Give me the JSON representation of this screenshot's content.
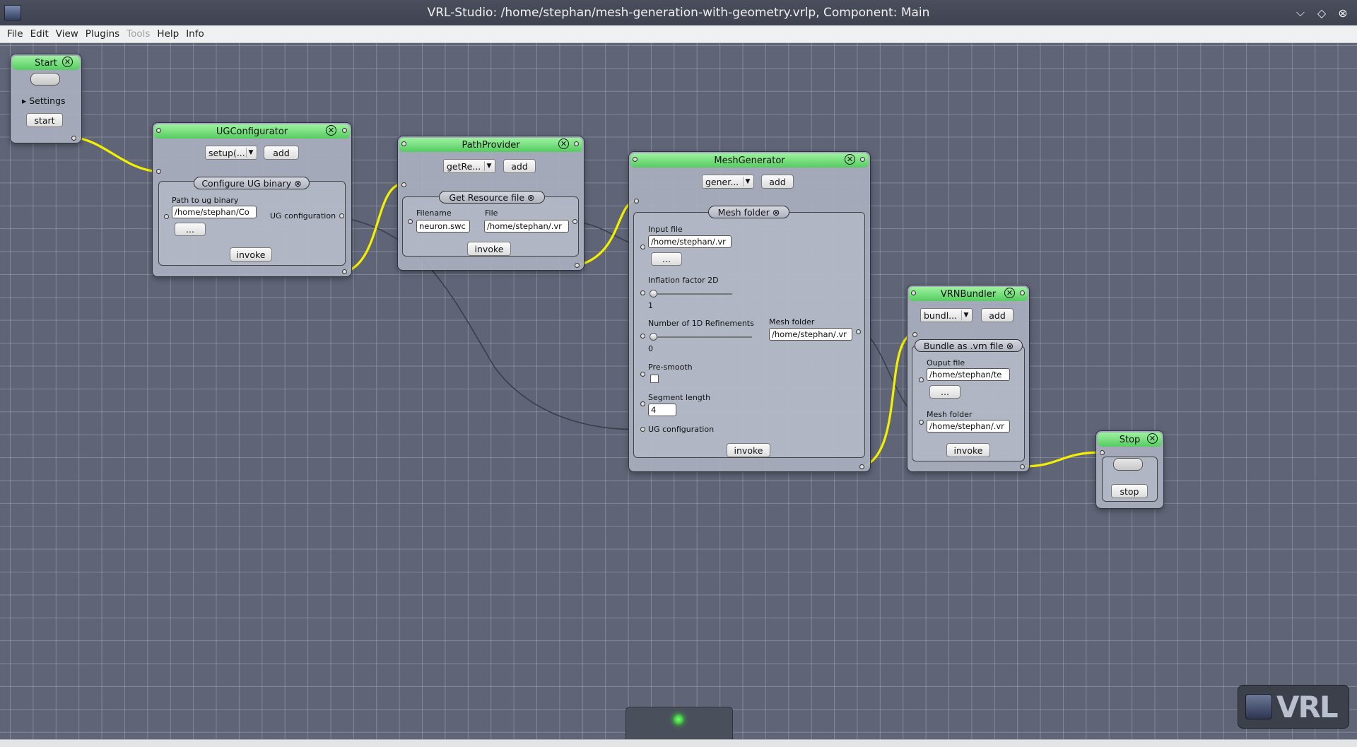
{
  "window": {
    "title": "VRL-Studio: /home/stephan/mesh-generation-with-geometry.vrlp, Component: Main"
  },
  "menu": [
    "File",
    "Edit",
    "View",
    "Plugins",
    "Tools",
    "Help",
    "Info"
  ],
  "start": {
    "title": "Start",
    "settings_label": "Settings",
    "button": "start"
  },
  "ug": {
    "title": "UGConfigurator",
    "method": "setup(...",
    "add": "add",
    "panel_title": "Configure UG binary",
    "path_label": "Path to ug binary",
    "path_value": "/home/stephan/Co",
    "browse": "...",
    "out_label": "UG configuration",
    "invoke": "invoke"
  },
  "pp": {
    "title": "PathProvider",
    "method": "getRe...",
    "add": "add",
    "panel_title": "Get Resource file",
    "filename_label": "Filename",
    "filename_value": "neuron.swc",
    "file_label": "File",
    "file_value": "/home/stephan/.vr",
    "invoke": "invoke"
  },
  "mg": {
    "title": "MeshGenerator",
    "method": "gener...",
    "add": "add",
    "panel_title": "Mesh folder",
    "input_label": "Input file",
    "input_value": "/home/stephan/.vr",
    "browse": "...",
    "inflation_label": "Inflation factor 2D",
    "inflation_value": "1",
    "refine_label": "Number of 1D Refinements",
    "refine_value": "0",
    "out_label": "Mesh folder",
    "out_value": "/home/stephan/.vr",
    "presmooth_label": "Pre-smooth",
    "segment_label": "Segment length",
    "segment_value": "4",
    "ug_label": "UG configuration",
    "invoke": "invoke"
  },
  "vb": {
    "title": "VRNBundler",
    "method": "bundl...",
    "add": "add",
    "panel_title": "Bundle as .vrn file",
    "output_label": "Ouput file",
    "output_value": "/home/stephan/te",
    "browse": "...",
    "mesh_label": "Mesh folder",
    "mesh_value": "/home/stephan/.vr",
    "invoke": "invoke"
  },
  "stop": {
    "title": "Stop",
    "button": "stop"
  },
  "logo": {
    "text": "VRL"
  },
  "colors": {
    "wire": "#f3f000",
    "title_bar": "#5fd66a",
    "canvas": "#5f6577"
  }
}
